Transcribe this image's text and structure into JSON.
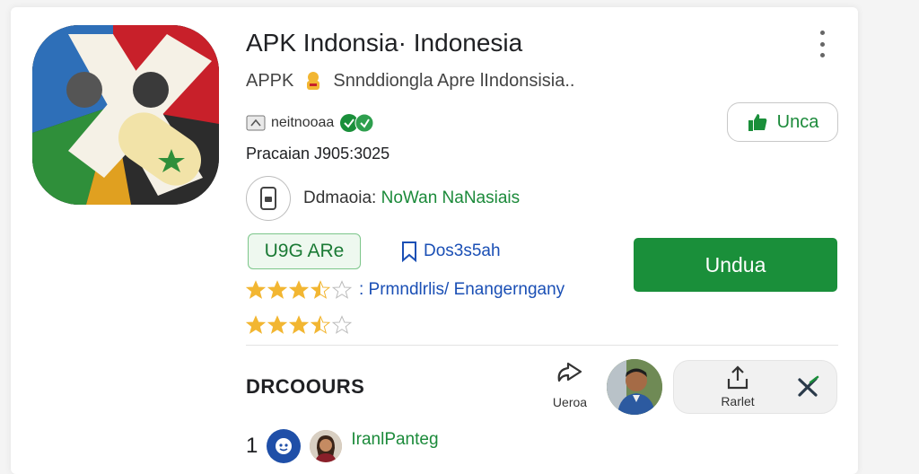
{
  "app": {
    "title": "APK Indonsia· Indonesia",
    "subtitle_prefix": "APPK",
    "subtitle_text": "Snnddiongla Apre lIndonsisia..",
    "developer": "neitnooaa",
    "date": "Pracaian  J905:3025",
    "device_label": "Ddmaoia:",
    "device_value": "NoWan NaNasiais"
  },
  "actions": {
    "install_label": "Unca",
    "badge_label": "U9G ARe",
    "bookmark_label": "Dos3s5ah",
    "download_label": "Undua"
  },
  "rating": {
    "value": 3.5,
    "max": 5,
    "text": ": Prmndlrlis/ Enangerngany",
    "value2": 3.5,
    "star_color": "#f2b632"
  },
  "section": {
    "title": "DRCOOURS",
    "share_label": "Ueroa",
    "report_label": "Rarlet"
  },
  "review": {
    "number": "1",
    "name": "IranlPanteg"
  },
  "colors": {
    "accent": "#1a8f3a",
    "link": "#1a4fb5"
  },
  "icons": {
    "more": "more-vert-icon",
    "install": "thumbs-up-icon",
    "device": "phone-icon",
    "bookmark": "bookmark-icon",
    "share": "share-icon",
    "report": "upload-icon",
    "close": "close-icon"
  }
}
